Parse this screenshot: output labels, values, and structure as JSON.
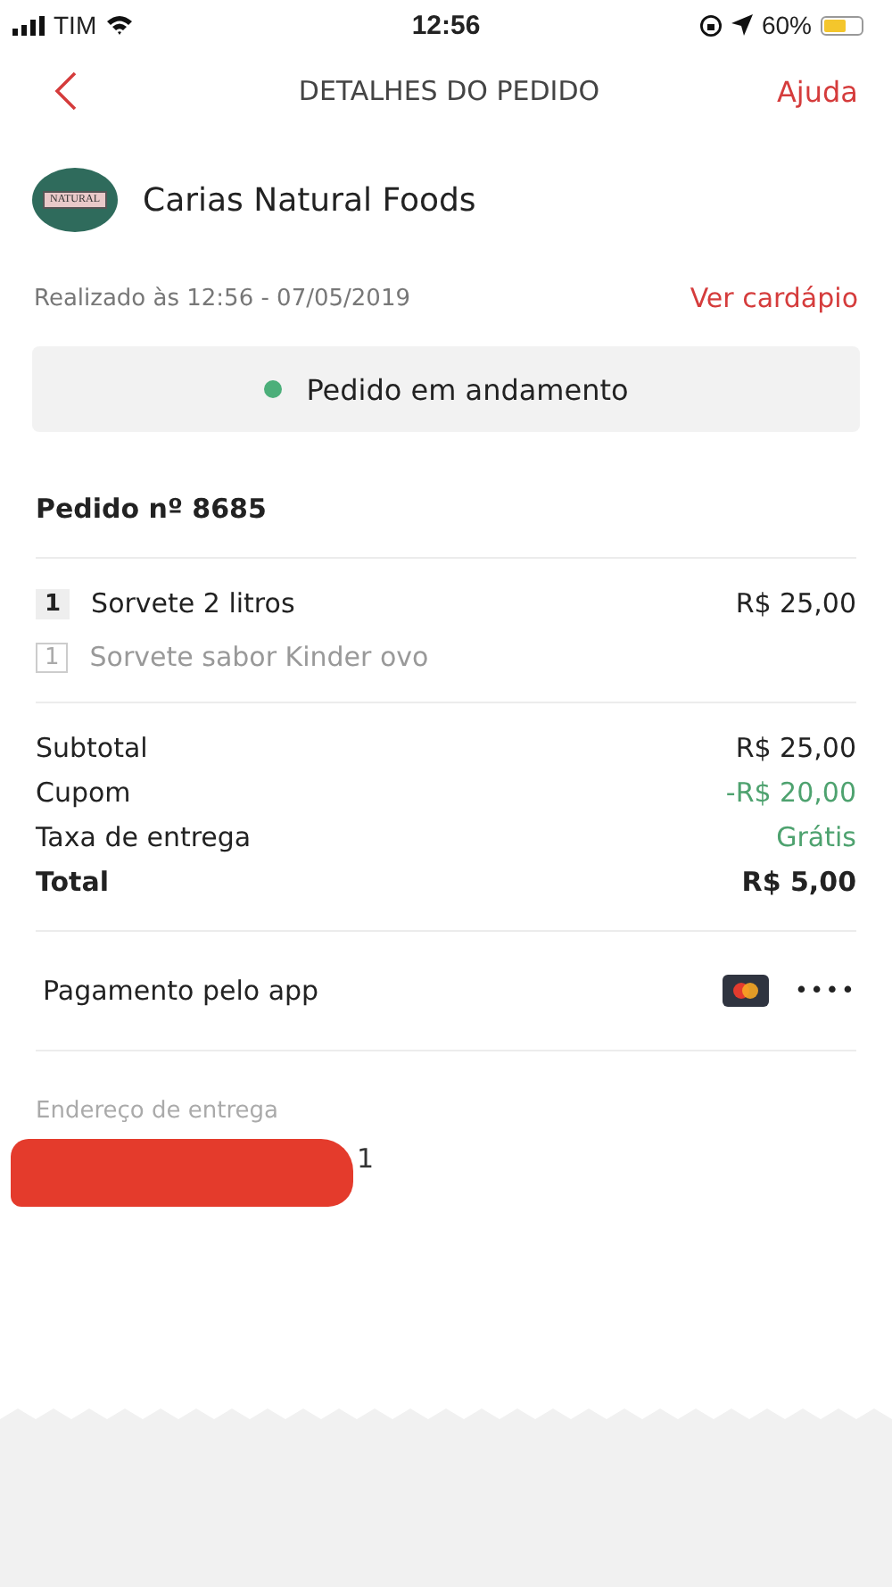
{
  "status_bar": {
    "carrier": "TIM",
    "time": "12:56",
    "battery_text": "60%",
    "battery": {
      "level": 0.6
    }
  },
  "header": {
    "title": "DETALHES DO PEDIDO",
    "help": "Ajuda"
  },
  "store": {
    "name": "Carias Natural Foods",
    "logo_text": "NATURAL"
  },
  "order_info": {
    "placed": "Realizado às 12:56 - 07/05/2019",
    "menu_link": "Ver cardápio"
  },
  "status": {
    "text": "Pedido em andamento",
    "color": "#4caf7a"
  },
  "order": {
    "number": "Pedido nº 8685",
    "items": [
      {
        "kind": "item",
        "qty": "1",
        "name": "Sorvete 2 litros",
        "price": "R$ 25,00"
      },
      {
        "kind": "option",
        "qty": "1",
        "name": "Sorvete sabor Kinder ovo"
      }
    ]
  },
  "totals": [
    {
      "label": "Subtotal",
      "value": "R$ 25,00",
      "kind": "normal"
    },
    {
      "label": "Cupom",
      "value": "-R$ 20,00",
      "kind": "discount"
    },
    {
      "label": "Taxa de entrega",
      "value": "Grátis",
      "kind": "discount"
    },
    {
      "label": "Total",
      "value": "R$ 5,00",
      "kind": "total"
    }
  ],
  "payment": {
    "label": "Pagamento pelo app",
    "card_digits": "••••"
  },
  "address": {
    "label": "Endereço de entrega",
    "visible_fragment": "1"
  }
}
